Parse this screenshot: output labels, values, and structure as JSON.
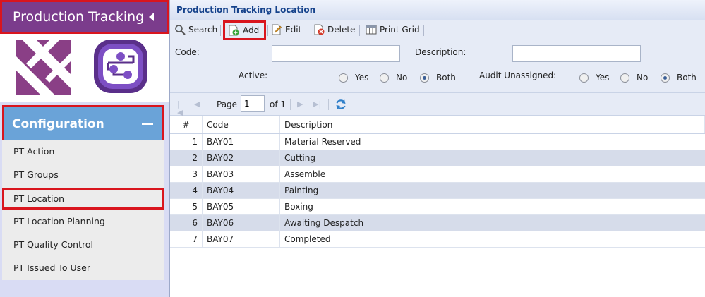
{
  "sidebar": {
    "app_title": "Production Tracking",
    "section_title": "Configuration",
    "items": [
      {
        "label": "PT Action"
      },
      {
        "label": "PT Groups"
      },
      {
        "label": "PT Location"
      },
      {
        "label": "PT Location Planning"
      },
      {
        "label": "PT Quality Control"
      },
      {
        "label": "PT Issued To User"
      }
    ],
    "active_item": "PT Location"
  },
  "panel": {
    "title": "Production Tracking Location"
  },
  "toolbar": {
    "search_label": "Search",
    "add_label": "Add",
    "edit_label": "Edit",
    "delete_label": "Delete",
    "print_label": "Print Grid"
  },
  "filter": {
    "code_label": "Code:",
    "code_value": "",
    "description_label": "Description:",
    "description_value": "",
    "active_label": "Active:",
    "audit_label": "Audit Unassigned:",
    "yes_label": "Yes",
    "no_label": "No",
    "both_label": "Both",
    "active_selected": "Both",
    "audit_selected": "Both"
  },
  "pager": {
    "page_label": "Page",
    "page_value": "1",
    "of_label": "of 1"
  },
  "grid": {
    "columns": [
      "#",
      "Code",
      "Description"
    ],
    "rows": [
      {
        "num": "1",
        "code": "BAY01",
        "desc": "Material Reserved"
      },
      {
        "num": "2",
        "code": "BAY02",
        "desc": "Cutting"
      },
      {
        "num": "3",
        "code": "BAY03",
        "desc": "Assemble"
      },
      {
        "num": "4",
        "code": "BAY04",
        "desc": "Painting"
      },
      {
        "num": "5",
        "code": "BAY05",
        "desc": "Boxing"
      },
      {
        "num": "6",
        "code": "BAY06",
        "desc": "Awaiting Despatch"
      },
      {
        "num": "7",
        "code": "BAY07",
        "desc": "Completed"
      }
    ]
  },
  "colors": {
    "header_purple": "#7b3c8c",
    "config_blue": "#6aa3d8",
    "highlight_red": "#d9151e",
    "panel_title_blue": "#15428b"
  }
}
